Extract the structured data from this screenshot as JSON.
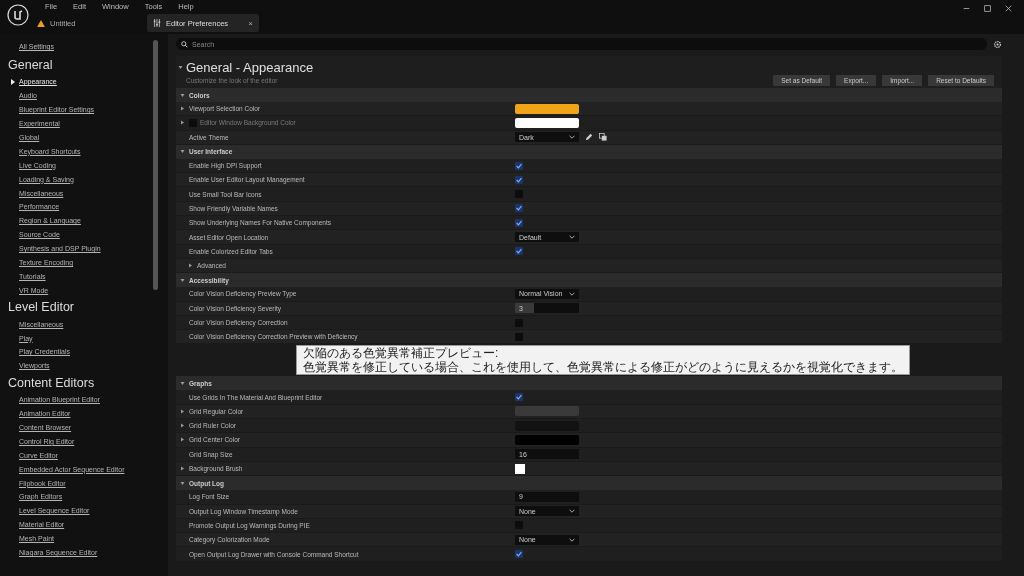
{
  "menu": [
    "File",
    "Edit",
    "Window",
    "Tools",
    "Help"
  ],
  "project_tab": {
    "label": "Untitled"
  },
  "tabs": [
    {
      "label": "Editor Preferences",
      "selected": true,
      "close": "×"
    }
  ],
  "search": {
    "placeholder": "Search"
  },
  "sidebar": {
    "all_settings": "All Settings",
    "groups": [
      {
        "title": "General",
        "items": [
          {
            "label": "Appearance",
            "selected": true
          },
          {
            "label": "Audio",
            "selected": false
          },
          {
            "label": "Blueprint Editor Settings",
            "selected": false
          },
          {
            "label": "Experimental",
            "selected": false
          },
          {
            "label": "Global",
            "selected": false
          },
          {
            "label": "Keyboard Shortcuts",
            "selected": false
          },
          {
            "label": "Live Coding",
            "selected": false
          },
          {
            "label": "Loading & Saving",
            "selected": false
          },
          {
            "label": "Miscellaneous",
            "selected": false
          },
          {
            "label": "Performance",
            "selected": false
          },
          {
            "label": "Region & Language",
            "selected": false
          },
          {
            "label": "Source Code",
            "selected": false
          },
          {
            "label": "Synthesis and DSP Plugin",
            "selected": false
          },
          {
            "label": "Texture Encoding",
            "selected": false
          },
          {
            "label": "Tutorials",
            "selected": false
          },
          {
            "label": "VR Mode",
            "selected": false
          }
        ]
      },
      {
        "title": "Level Editor",
        "items": [
          {
            "label": "Miscellaneous",
            "selected": false
          },
          {
            "label": "Play",
            "selected": false
          },
          {
            "label": "Play Credentials",
            "selected": false
          },
          {
            "label": "Viewports",
            "selected": false
          }
        ]
      },
      {
        "title": "Content Editors",
        "items": [
          {
            "label": "Animation Blueprint Editor",
            "selected": false
          },
          {
            "label": "Animation Editor",
            "selected": false
          },
          {
            "label": "Content Browser",
            "selected": false
          },
          {
            "label": "Control Rig Editor",
            "selected": false
          },
          {
            "label": "Curve Editor",
            "selected": false
          },
          {
            "label": "Embedded Actor Sequence Editor",
            "selected": false
          },
          {
            "label": "Flipbook Editor",
            "selected": false
          },
          {
            "label": "Graph Editors",
            "selected": false
          },
          {
            "label": "Level Sequence Editor",
            "selected": false
          },
          {
            "label": "Material Editor",
            "selected": false
          },
          {
            "label": "Mesh Paint",
            "selected": false
          },
          {
            "label": "Niagara Sequence Editor",
            "selected": false
          }
        ]
      }
    ]
  },
  "page": {
    "title": "General - Appearance",
    "expanded": true,
    "subtitle": "Customize the look of the editor",
    "buttons": [
      "Set as Default",
      "Export...",
      "Import...",
      "Reset to Defaults"
    ]
  },
  "sections": [
    {
      "title": "Colors",
      "expanded": true,
      "rows": [
        {
          "label": "Viewport Selection Color",
          "kind": "color",
          "expanded": false,
          "color": "#f0a518"
        },
        {
          "label": "Editor Window Background Color",
          "kind": "color",
          "expanded": false,
          "color": "#ffffff",
          "disabled": true,
          "override_checked": false
        },
        {
          "label": "Active Theme",
          "kind": "theme",
          "value": "Dark"
        }
      ]
    },
    {
      "title": "User Interface",
      "expanded": true,
      "rows": [
        {
          "label": "Enable High DPI Support",
          "kind": "checkbox",
          "checked": true
        },
        {
          "label": "Enable User Editor Layout Management",
          "kind": "checkbox",
          "checked": true
        },
        {
          "label": "Use Small Tool Bar Icons",
          "kind": "checkbox",
          "checked": false
        },
        {
          "label": "Show Friendly Variable Names",
          "kind": "checkbox",
          "checked": true
        },
        {
          "label": "Show Underlying Names For Native Components",
          "kind": "checkbox",
          "checked": true
        },
        {
          "label": "Asset Editor Open Location",
          "kind": "dropdown",
          "value": "Default"
        },
        {
          "label": "Enable Colorized Editor Tabs",
          "kind": "checkbox",
          "checked": true
        },
        {
          "label": "Advanced",
          "kind": "group",
          "expanded": false
        }
      ]
    },
    {
      "title": "Accessibility",
      "expanded": true,
      "rows": [
        {
          "label": "Color Vision Deficiency Preview Type",
          "kind": "dropdown",
          "value": "Normal Vision"
        },
        {
          "label": "Color Vision Deficiency Severity",
          "kind": "slider",
          "value": "3",
          "level": 0.3
        },
        {
          "label": "Color Vision Deficiency Correction",
          "kind": "checkbox",
          "checked": false
        },
        {
          "label": "Color Vision Deficiency Correction Preview with Deficiency",
          "kind": "checkbox",
          "checked": false,
          "tooltip": [
            "欠陥のある色覚異常補正プレビュー:",
            "色覚異常を修正している場合、これを使用して、色覚異常による修正がどのように見えるかを視覚化できます。"
          ]
        }
      ]
    },
    {
      "title": "Graphs",
      "expanded": true,
      "rows": [
        {
          "label": "Use Grids In The Material And Blueprint Editor",
          "kind": "checkbox",
          "checked": true
        },
        {
          "label": "Grid Regular Color",
          "kind": "color",
          "expanded": false,
          "color": "#3a3a3a"
        },
        {
          "label": "Grid Ruler Color",
          "kind": "color",
          "expanded": false,
          "color": "#121212"
        },
        {
          "label": "Grid Center Color",
          "kind": "color",
          "expanded": false,
          "color": "#000000"
        },
        {
          "label": "Grid Snap Size",
          "kind": "number",
          "value": "16"
        },
        {
          "label": "Background Brush",
          "kind": "brush",
          "expanded": false,
          "color": "#ffffff"
        }
      ]
    },
    {
      "title": "Output Log",
      "expanded": true,
      "rows": [
        {
          "label": "Log Font Size",
          "kind": "number",
          "value": "9"
        },
        {
          "label": "Output Log Window Timestamp Mode",
          "kind": "dropdown",
          "value": "None"
        },
        {
          "label": "Promote Output Log Warnings During PIE",
          "kind": "checkbox",
          "checked": false
        },
        {
          "label": "Category Colorization Mode",
          "kind": "dropdown",
          "value": "None"
        },
        {
          "label": "Open Output Log Drawer with Console Command Shortcut",
          "kind": "checkbox",
          "checked": true
        }
      ]
    }
  ]
}
